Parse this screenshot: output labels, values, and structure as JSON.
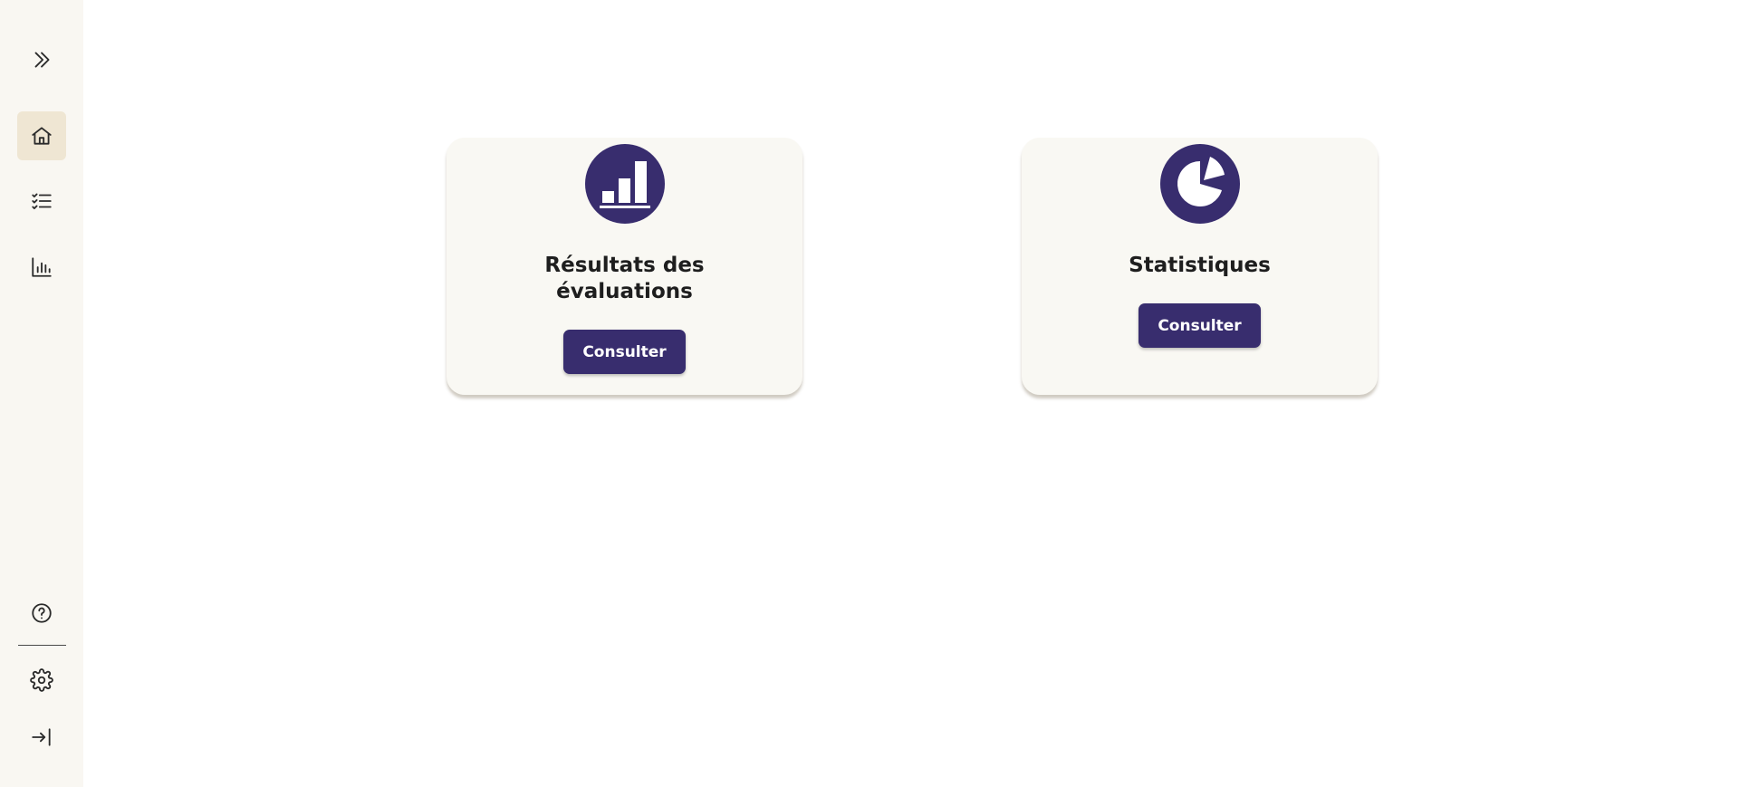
{
  "sidebar": {
    "items": [
      {
        "id": "expand",
        "icon": "chevrons-right-icon"
      },
      {
        "id": "home",
        "icon": "home-icon",
        "active": true
      },
      {
        "id": "checklist",
        "icon": "checklist-icon"
      },
      {
        "id": "chart",
        "icon": "bar-chart-icon"
      },
      {
        "id": "help",
        "icon": "help-circle-icon"
      },
      {
        "id": "settings",
        "icon": "gear-icon"
      },
      {
        "id": "logout",
        "icon": "sign-in-arrow-icon"
      }
    ]
  },
  "cards": [
    {
      "title": "Résultats des évaluations",
      "button_label": "Consulter",
      "icon": "bar-chart-icon"
    },
    {
      "title": "Statistiques",
      "button_label": "Consulter",
      "icon": "pie-chart-icon"
    }
  ],
  "colors": {
    "accent": "#382d6e",
    "sidebar_bg": "#f9f7f2",
    "active_item_bg": "#efe6d3",
    "card_bg": "#f9f8f3"
  }
}
